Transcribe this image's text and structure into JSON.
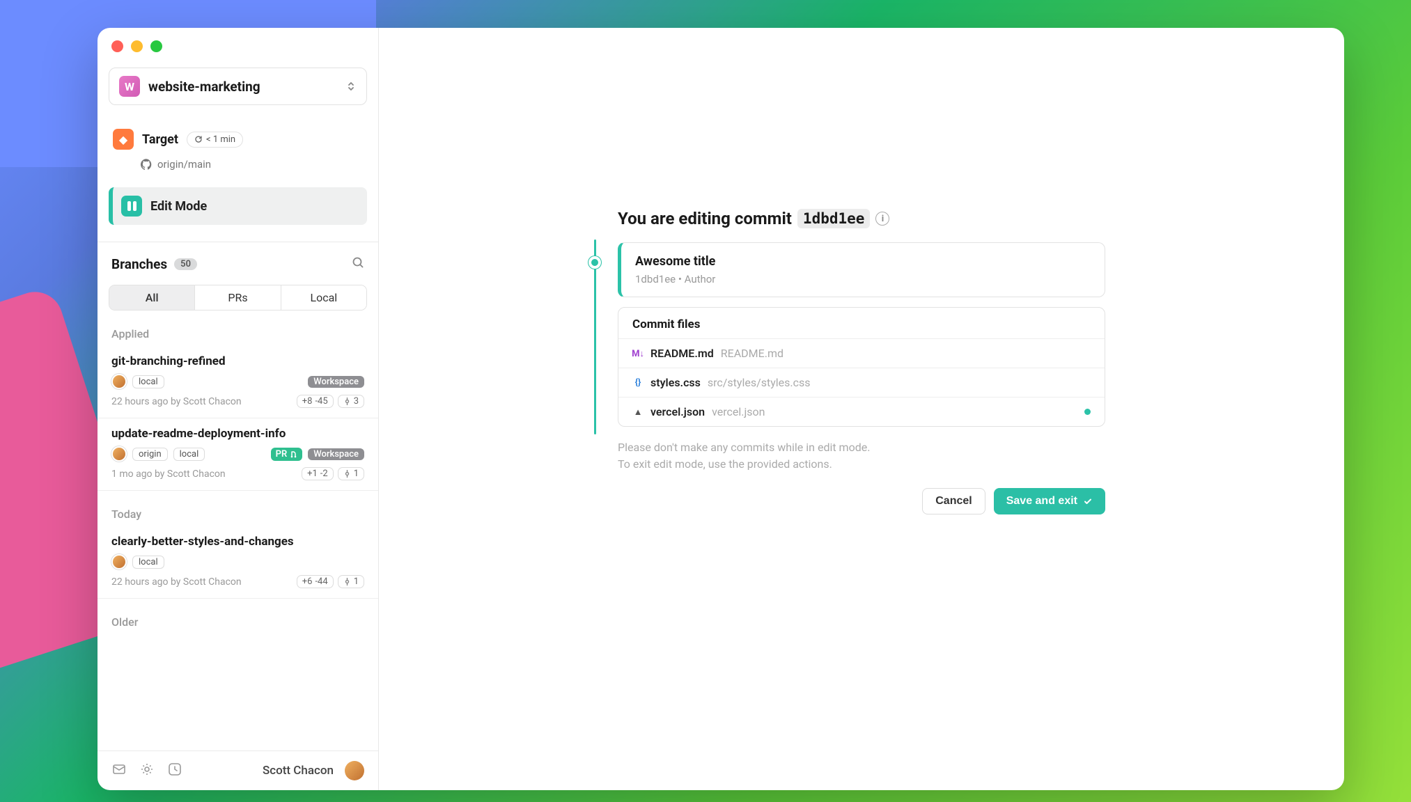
{
  "workspace": {
    "initial": "W",
    "name": "website-marketing"
  },
  "target": {
    "label": "Target",
    "time": "< 1 min",
    "remote": "origin/main"
  },
  "editMode": {
    "label": "Edit Mode"
  },
  "branches": {
    "title": "Branches",
    "count": "50",
    "tabs": {
      "all": "All",
      "prs": "PRs",
      "local": "Local"
    }
  },
  "sections": {
    "applied": "Applied",
    "today": "Today",
    "older": "Older"
  },
  "branchItems": {
    "applied": [
      {
        "name": "git-branching-refined",
        "tags": {
          "local": "local",
          "workspace": "Workspace"
        },
        "meta": "22 hours ago by Scott Chacon",
        "plus": "+8",
        "minus": "-45",
        "commits": "3"
      },
      {
        "name": "update-readme-deployment-info",
        "tags": {
          "origin": "origin",
          "local": "local",
          "pr": "PR",
          "workspace": "Workspace"
        },
        "meta": "1 mo ago by Scott Chacon",
        "plus": "+1",
        "minus": "-2",
        "commits": "1"
      }
    ],
    "today": [
      {
        "name": "clearly-better-styles-and-changes",
        "tags": {
          "local": "local"
        },
        "meta": "22 hours ago by Scott Chacon",
        "plus": "+6",
        "minus": "-44",
        "commits": "1"
      }
    ]
  },
  "footer": {
    "user": "Scott Chacon"
  },
  "main": {
    "heading_prefix": "You are editing commit ",
    "commit_hash": "1dbd1ee",
    "commit": {
      "title": "Awesome title",
      "meta": "1dbd1ee  •  Author"
    },
    "files": {
      "header": "Commit files",
      "items": [
        {
          "name": "README.md",
          "path": "README.md",
          "icon": "md"
        },
        {
          "name": "styles.css",
          "path": "src/styles/styles.css",
          "icon": "css"
        },
        {
          "name": "vercel.json",
          "path": "vercel.json",
          "icon": "json",
          "dot": true
        }
      ]
    },
    "hint1": "Please don't make any commits while in edit mode.",
    "hint2": "To exit edit mode, use the provided actions.",
    "cancel": "Cancel",
    "save": "Save and exit"
  }
}
